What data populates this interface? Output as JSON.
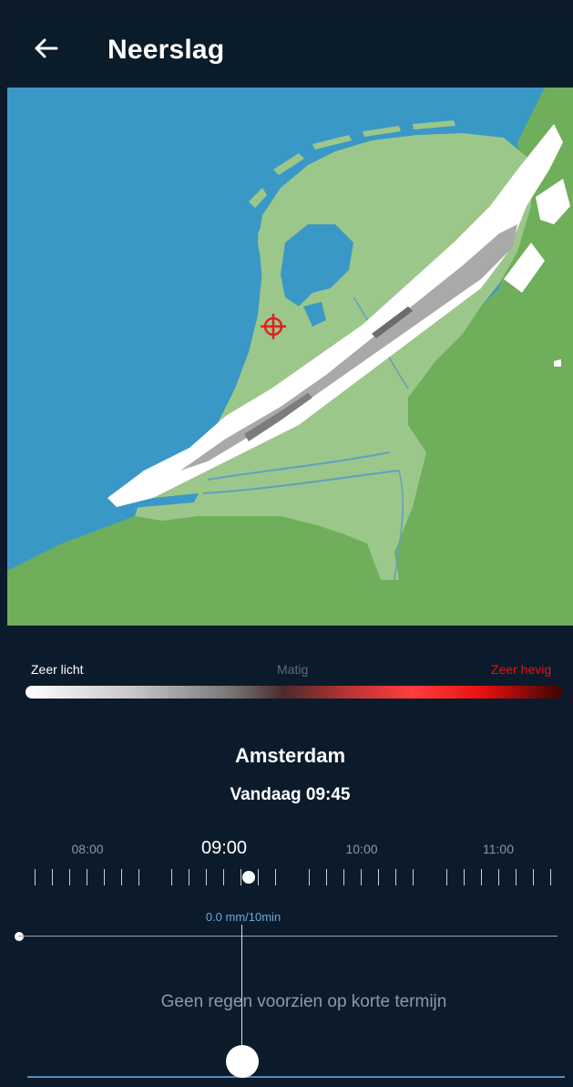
{
  "header": {
    "title": "Neerslag",
    "back_icon": "arrow-left-icon"
  },
  "map": {
    "location_marker_icon": "crosshair-target-icon",
    "marker_color": "#e02020",
    "water_color": "#3a98c6",
    "land_color": "#6fae5a",
    "nl_land_color": "#9cc78a"
  },
  "legend": {
    "left": "Zeer licht",
    "middle": "Matig",
    "right": "Zeer hevig",
    "left_color": "#ffffff",
    "middle_color": "#5d6b78",
    "right_color": "#e81010"
  },
  "location": {
    "city": "Amsterdam",
    "datetime": "Vandaag 09:45"
  },
  "timeline": {
    "hours": [
      {
        "label": "08:00",
        "active": false
      },
      {
        "label": "09:00",
        "active": true
      },
      {
        "label": "10:00",
        "active": false
      },
      {
        "label": "11:00",
        "active": false
      }
    ]
  },
  "rain": {
    "value": "0.0 mm/10min",
    "forecast": "Geen regen voorzien op korte termijn"
  }
}
